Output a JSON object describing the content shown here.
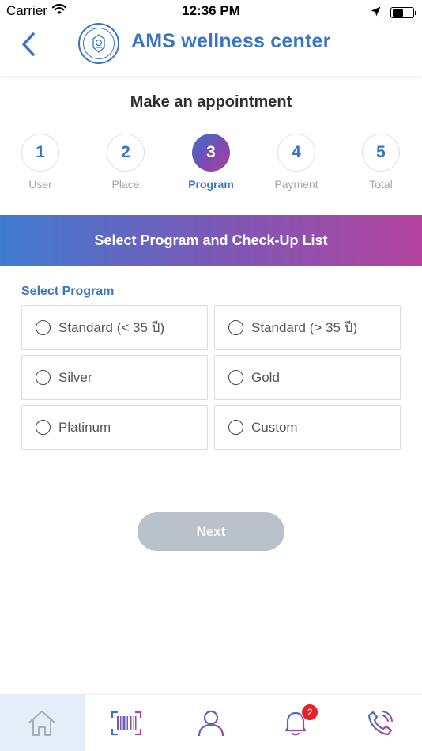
{
  "status_bar": {
    "carrier": "Carrier",
    "time": "12:36 PM",
    "battery_level": 0.55
  },
  "header": {
    "title": "AMS wellness center",
    "logo_icon": "ams-logo-icon",
    "back_icon": "chevron-left-icon"
  },
  "page_title": "Make an appointment",
  "stepper": {
    "current": 3,
    "steps": [
      {
        "number": "1",
        "label": "User"
      },
      {
        "number": "2",
        "label": "Place"
      },
      {
        "number": "3",
        "label": "Program"
      },
      {
        "number": "4",
        "label": "Payment"
      },
      {
        "number": "5",
        "label": "Total"
      }
    ]
  },
  "banner": "Select Program and Check-Up List",
  "section_label": "Select Program",
  "programs": [
    {
      "label": "Standard (< 35 ปี)",
      "selected": false
    },
    {
      "label": "Standard (> 35 ปี)",
      "selected": false
    },
    {
      "label": "Silver",
      "selected": false
    },
    {
      "label": "Gold",
      "selected": false
    },
    {
      "label": "Platinum",
      "selected": false
    },
    {
      "label": "Custom",
      "selected": false
    }
  ],
  "next_button": {
    "label": "Next",
    "enabled": false
  },
  "tabbar": {
    "active": "home",
    "items": [
      {
        "name": "home",
        "icon": "home-icon"
      },
      {
        "name": "scan",
        "icon": "barcode-icon"
      },
      {
        "name": "profile",
        "icon": "user-icon"
      },
      {
        "name": "notifications",
        "icon": "bell-icon",
        "badge": "2"
      },
      {
        "name": "call",
        "icon": "phone-icon"
      }
    ]
  },
  "colors": {
    "primary": "#3a74c4",
    "gradient_start": "#3f7bcf",
    "gradient_end": "#b3439e",
    "badge": "#e8202a",
    "disabled_button": "#b9c1cb"
  }
}
